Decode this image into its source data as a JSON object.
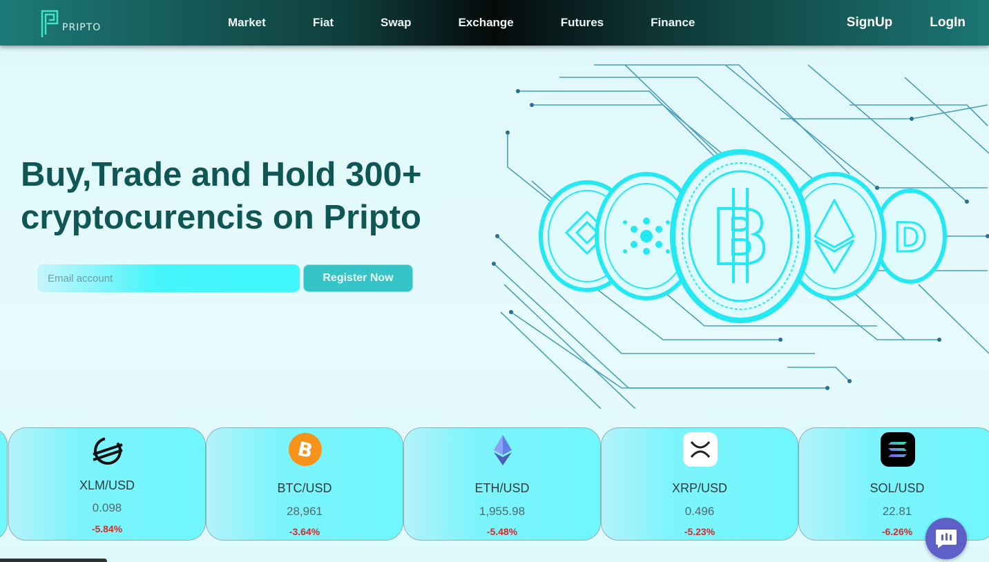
{
  "brand": {
    "name": "PRIPTO"
  },
  "nav": {
    "links": [
      "Market",
      "Fiat",
      "Swap",
      "Exchange",
      "Futures",
      "Finance"
    ],
    "signup": "SignUp",
    "login": "LogIn"
  },
  "hero": {
    "title_line1": "Buy,Trade and Hold 300+",
    "title_line2": "cryptocurencis on Pripto",
    "email_placeholder": "Email account",
    "register_label": "Register Now"
  },
  "ticker": [
    {
      "pair": "XLM/USD",
      "price": "0.098",
      "change": "-5.84%",
      "icon": "stellar-icon"
    },
    {
      "pair": "BTC/USD",
      "price": "28,961",
      "change": "-3.64%",
      "icon": "bitcoin-icon"
    },
    {
      "pair": "ETH/USD",
      "price": "1,955.98",
      "change": "-5.48%",
      "icon": "ethereum-icon"
    },
    {
      "pair": "XRP/USD",
      "price": "0.496",
      "change": "-5.23%",
      "icon": "xrp-icon"
    },
    {
      "pair": "SOL/USD",
      "price": "22.81",
      "change": "-6.26%",
      "icon": "solana-icon"
    }
  ],
  "colors": {
    "accent": "#0f5655",
    "negative": "#d32b2b",
    "cyan": "#3ff8fd",
    "chat": "#5f5fc8"
  }
}
